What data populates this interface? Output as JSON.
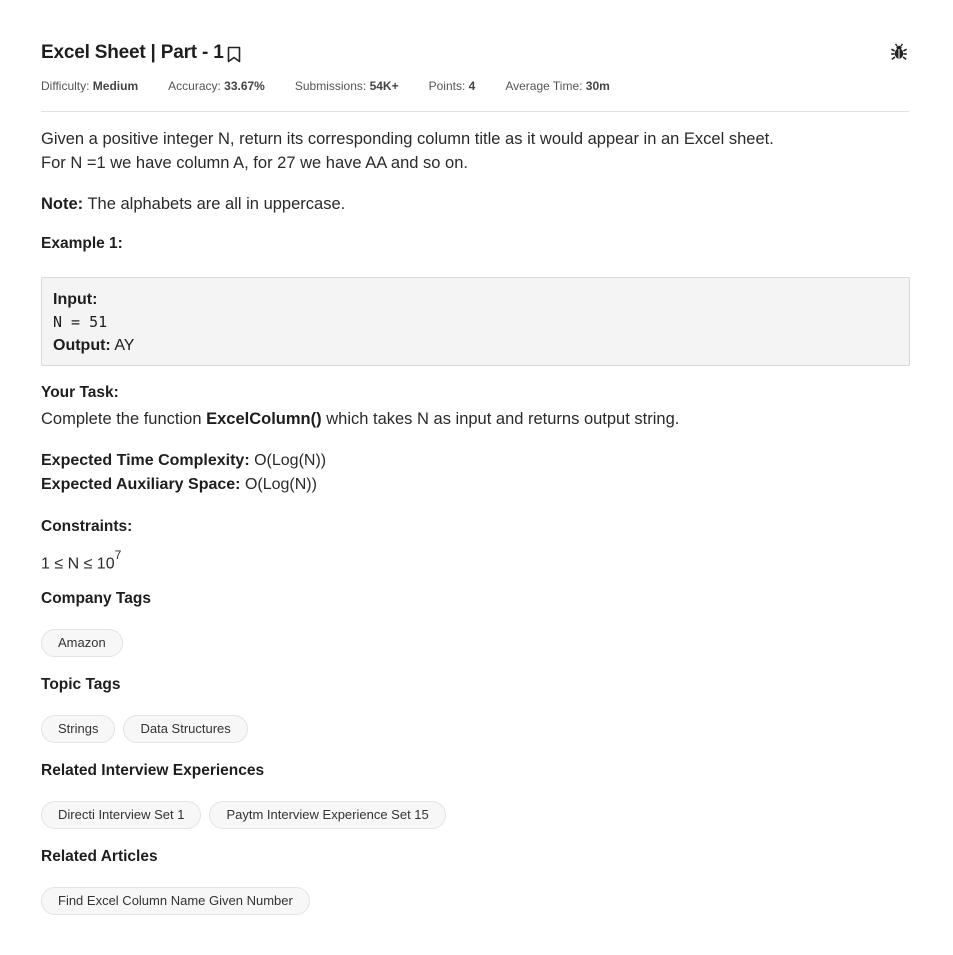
{
  "problem": {
    "title": "Excel Sheet | Part - 1",
    "meta": {
      "difficulty_label": "Difficulty: ",
      "difficulty_value": "Medium",
      "accuracy_label": "Accuracy: ",
      "accuracy_value": "33.67%",
      "submissions_label": "Submissions: ",
      "submissions_value": "54K+",
      "points_label": "Points: ",
      "points_value": "4",
      "time_label": "Average Time: ",
      "time_value": "30m"
    },
    "description_line1": "Given a positive integer N, return its corresponding column title as it would appear in an Excel sheet.",
    "description_line2": "For N =1 we have column A, for 27 we have AA and so on.",
    "note_label": "Note:",
    "note_text": " The alphabets are all in uppercase.",
    "example_title": "Example 1:",
    "example": {
      "input_label": "Input:",
      "input_value": "N = 51",
      "output_label": "Output:",
      "output_value": " AY"
    },
    "task_title": "Your Task:",
    "task_prefix": "Complete the function ",
    "task_function": "ExcelColumn()",
    "task_suffix": " which takes N as input and returns output string.",
    "time_complexity_label": "Expected Time Complexity:",
    "time_complexity_value": " O(Log(N))",
    "aux_space_label": "Expected Auxiliary Space:",
    "aux_space_value": " O(Log(N))",
    "constraints_title": "Constraints:",
    "constraint_base": "1 ≤ N ≤ 10",
    "constraint_exp": "7"
  },
  "company_tags": {
    "title": "Company Tags",
    "items": [
      "Amazon"
    ]
  },
  "topic_tags": {
    "title": "Topic Tags",
    "items": [
      "Strings",
      "Data Structures"
    ]
  },
  "interview_experiences": {
    "title": "Related Interview Experiences",
    "items": [
      "Directi Interview Set 1",
      "Paytm Interview Experience Set 15"
    ]
  },
  "related_articles": {
    "title": "Related Articles",
    "items": [
      "Find Excel Column Name Given Number"
    ]
  },
  "icons": {
    "bookmark": "bookmark-icon",
    "bug": "bug-report-icon"
  }
}
